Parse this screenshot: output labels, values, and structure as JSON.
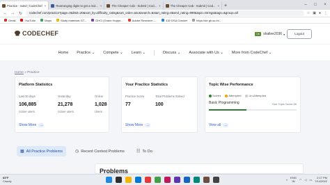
{
  "browser": {
    "tabs": [
      {
        "title": "Practice - rated | CodeChef",
        "active": true,
        "favicon_color": "#6b4c2e"
      },
      {
        "title": "Rearranging digits to get a mul...",
        "active": false,
        "favicon_color": "#3c5a99"
      },
      {
        "title": "The Cheaper Cab - Submit | Cod...",
        "active": false,
        "favicon_color": "#6b4c2e"
      },
      {
        "title": "The Cheaper Cab - Submit | Cod...",
        "active": false,
        "favicon_color": "#6b4c2e"
      }
    ],
    "url": "codechef.com/practice?page=0&limit=20&sort_by=difficulty_rating&sort_order=asc&search=&start_rating=0&end_rating=999&topic=Strings&tags=&group=all",
    "bookmarks": [
      {
        "label": "Gmail",
        "color": "#d93025"
      },
      {
        "label": "YouTube",
        "color": "#ff0000"
      },
      {
        "label": "Maps",
        "color": "#34a853"
      },
      {
        "label": "Study materials GT...",
        "color": "#f4b400"
      },
      {
        "label": "GHCI (Grace Hoppe...",
        "color": "#7b3fbf"
      },
      {
        "label": "Adobe Research -...",
        "color": "#e53935"
      },
      {
        "label": "430 DSA Cracker",
        "color": "#1e88e5"
      },
      {
        "label": "https://de.gh.ac.in/...",
        "color": "#9e9e9e"
      }
    ]
  },
  "header": {
    "logo_text": "CODECHEF",
    "username": "shailee2036",
    "star_badge": "1★",
    "logout_label": "Logout"
  },
  "nav": {
    "items": [
      "Home",
      "Practice",
      "Compete",
      "Learn",
      "Discuss",
      "Associate with Us",
      "More from CodeChef"
    ]
  },
  "breadcrumb": {
    "home": "Home",
    "separator": "»",
    "current": "Practice"
  },
  "platform_stats": {
    "title": "Platform Statistics",
    "columns": [
      {
        "period": "Last 30 days",
        "value": "106,885",
        "unit": "Active users"
      },
      {
        "period": "Yesterday",
        "value": "21,278",
        "unit": "Active users"
      },
      {
        "period": "Online",
        "value": "1,028",
        "unit": "Users"
      }
    ],
    "more_label": "Show More"
  },
  "practice_stats": {
    "title": "Your Practice Statistics",
    "score_label": "Practice Score",
    "score_value": "77",
    "solved_label": "Total Problems Solved",
    "solved_value": "100",
    "more_label": "Show More"
  },
  "topic_performance": {
    "title": "Topic Wise Performance",
    "legend": [
      {
        "label": "Solved",
        "color": "#2e7d32"
      },
      {
        "label": "Attempted",
        "color": "#f59e0b"
      },
      {
        "label": "Un-Attempted",
        "color": "#c5cad1"
      }
    ],
    "topic_name": "Basic Programming",
    "topic_score_label": "Your Topic Score 66",
    "solved_fraction": 0.43,
    "view_label": "View all"
  },
  "practice_tabs": [
    {
      "label": "All Practice Problems",
      "active": true
    },
    {
      "label": "Recent Contest Problems",
      "active": false
    },
    {
      "label": "To Do",
      "active": false
    }
  ],
  "problems_heading": "Problems",
  "taskbar": {
    "temp": "83°F",
    "weather": "Cloudy",
    "lang": "ENG",
    "region": "IN",
    "time": "2:17 PM",
    "date": "7/14/2022",
    "apps": [
      "#1e88e5",
      "#2f2f2f",
      "#f4b400",
      "#0078d4",
      "#e53935",
      "#43a047",
      "#c2185b",
      "#5e35b1",
      "#1565c0",
      "#00897b",
      "#6d4c41",
      "#424242"
    ]
  }
}
